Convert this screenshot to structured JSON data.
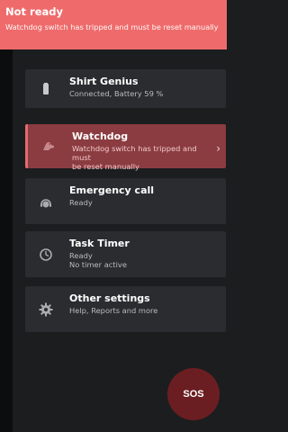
{
  "banner": {
    "title": "Not ready",
    "message": "Watchdog switch has tripped and must be reset manually"
  },
  "cards": [
    {
      "title": "Shirt Genius",
      "lines": [
        "Connected, Battery 59 %"
      ],
      "icon": "phone-battery-icon"
    },
    {
      "title": "Watchdog",
      "lines": [
        "Watchdog switch has tripped and must",
        "be reset manually"
      ],
      "icon": "dog-icon",
      "chevron": "›"
    },
    {
      "title": "Emergency call",
      "lines": [
        "Ready"
      ],
      "icon": "support-agent-icon"
    },
    {
      "title": "Task Timer",
      "lines": [
        "Ready",
        "No timer active"
      ],
      "icon": "clock-icon"
    },
    {
      "title": "Other settings",
      "lines": [
        "Help, Reports and more"
      ],
      "icon": "gear-icon"
    }
  ],
  "sos": {
    "label": "SOS"
  },
  "colors": {
    "banner": "#ef6b6b",
    "active_card": "#8b3c40",
    "card": "#2a2c2f",
    "background": "#1b1d1f",
    "sos": "#6b1e21"
  }
}
